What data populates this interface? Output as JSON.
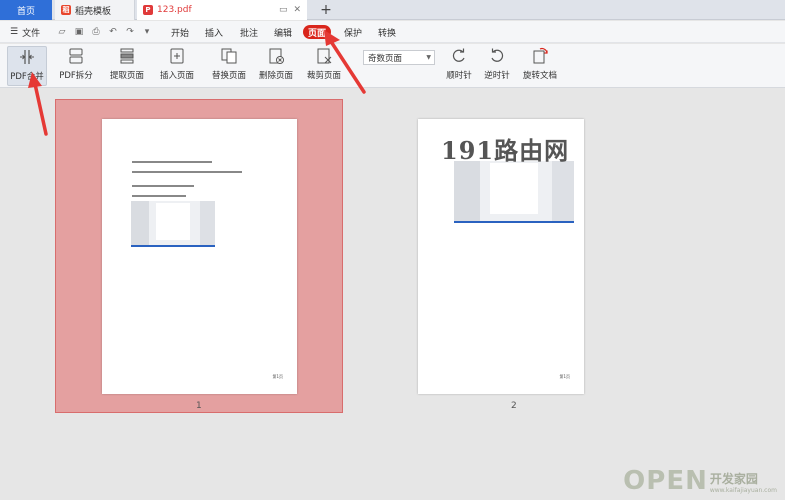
{
  "tabs": {
    "home": "首页",
    "template": "稻壳模板",
    "pdf": "123.pdf",
    "add": "+"
  },
  "menu": {
    "file": "文件",
    "items": [
      "开始",
      "插入",
      "批注",
      "编辑",
      "页面",
      "保护",
      "转换"
    ],
    "active": "页面"
  },
  "ribbon": {
    "merge": "PDF合并",
    "split": "PDF拆分",
    "extract": "提取页面",
    "insert": "插入页面",
    "replace": "替换页面",
    "delete": "删除页面",
    "crop": "裁剪页面",
    "page_select": "奇数页面",
    "clockwise": "顺时针",
    "counterclockwise": "逆时针",
    "rotate": "旋转文档"
  },
  "pages": {
    "page1": {
      "number": "1",
      "footer": "第1页"
    },
    "page2": {
      "number": "2",
      "footer": "第1页"
    }
  },
  "watermarks": {
    "center": "191路由网",
    "corner_big": "OPEN",
    "corner_small_1": "开发家园",
    "corner_small_2": "www.kaifajiayuan.com"
  },
  "colors": {
    "accent_red": "#d9261c",
    "tab_blue": "#2f6fd8",
    "selection": "#e4a0a0"
  }
}
